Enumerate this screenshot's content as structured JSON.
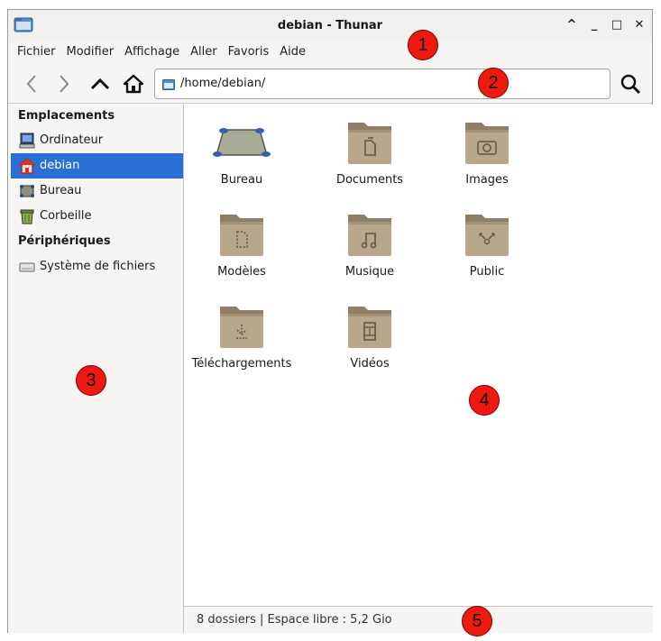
{
  "window": {
    "title": "debian - Thunar"
  },
  "wm_buttons": [
    "^",
    "_",
    "□",
    "✕"
  ],
  "menubar": [
    "Fichier",
    "Modifier",
    "Affichage",
    "Aller",
    "Favoris",
    "Aide"
  ],
  "toolbar": {
    "back_icon": "chevron-left-icon",
    "forward_icon": "chevron-right-icon",
    "up_icon": "chevron-up-icon",
    "home_icon": "home-icon",
    "address": "/home/debian/",
    "search_icon": "search-icon"
  },
  "sidebar": {
    "sections": [
      {
        "title": "Emplacements",
        "items": [
          {
            "label": "Ordinateur",
            "icon": "computer-icon"
          },
          {
            "label": "debian",
            "icon": "home-folder-icon",
            "selected": true
          },
          {
            "label": "Bureau",
            "icon": "desktop-icon"
          },
          {
            "label": "Corbeille",
            "icon": "trash-icon"
          }
        ]
      },
      {
        "title": "Périphériques",
        "items": [
          {
            "label": "Système de fichiers",
            "icon": "drive-icon"
          }
        ]
      }
    ]
  },
  "files": [
    {
      "name": "Bureau",
      "icon": "desktop-folder-icon"
    },
    {
      "name": "Documents",
      "icon": "documents-folder-icon"
    },
    {
      "name": "Images",
      "icon": "pictures-folder-icon"
    },
    {
      "name": "Modèles",
      "icon": "templates-folder-icon"
    },
    {
      "name": "Musique",
      "icon": "music-folder-icon"
    },
    {
      "name": "Public",
      "icon": "public-folder-icon"
    },
    {
      "name": "Téléchargements",
      "icon": "downloads-folder-icon"
    },
    {
      "name": "Vidéos",
      "icon": "videos-folder-icon"
    }
  ],
  "statusbar": {
    "text": "8 dossiers  |  Espace libre : 5,2 Gio"
  },
  "markers": [
    "1",
    "2",
    "3",
    "4",
    "5"
  ],
  "colors": {
    "selection": "#2a6fd6",
    "folder": "#b8a78b",
    "marker": "#ee1a10"
  }
}
